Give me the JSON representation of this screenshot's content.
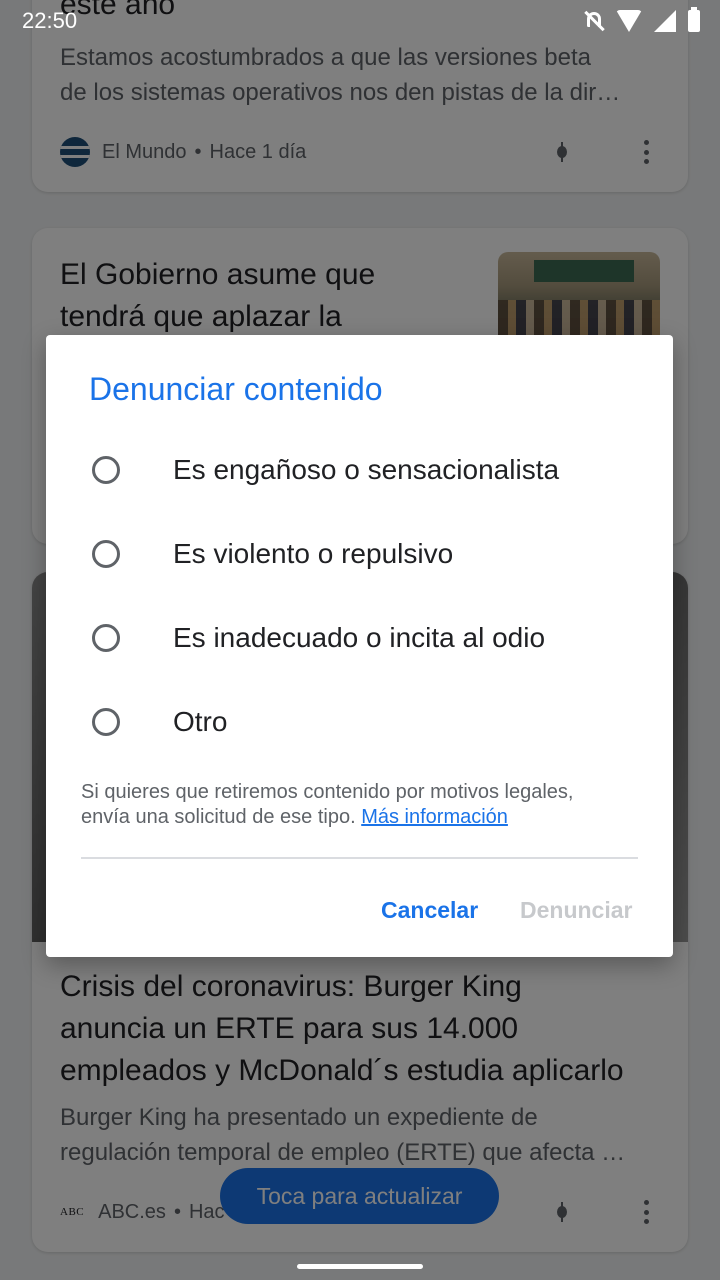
{
  "status_bar": {
    "time": "22:50",
    "icons": [
      "notifications-off-icon",
      "wifi-icon",
      "signal-icon",
      "battery-icon"
    ]
  },
  "feed": {
    "card1": {
      "title_partial": "este año",
      "snippet_line1": "Estamos acostumbrados a que las versiones beta",
      "snippet_line2": "de los sistemas operativos nos den pistas de la dir…",
      "publisher": "El Mundo",
      "time": "Hace 1 día"
    },
    "card2": {
      "title_line1": "El Gobierno asume que",
      "title_line2": "tendrá que aplazar la"
    },
    "card3": {
      "title_line1": "Crisis del coronavirus: Burger King",
      "title_line2": "anuncia un ERTE para sus 14.000",
      "title_line3": "empleados y McDonald´s estudia aplicarlo",
      "snippet_line1": "Burger King ha presentado un expediente de",
      "snippet_line2": "regulación temporal de empleo (ERTE) que afecta …",
      "publisher_logo": "ABC",
      "publisher": "ABC.es",
      "time_partial": "Hac"
    },
    "refresh_button": "Toca para actualizar"
  },
  "dialog": {
    "title": "Denunciar contenido",
    "options": [
      {
        "label": "Es engañoso o sensacionalista",
        "selected": false
      },
      {
        "label": "Es violento o repulsivo",
        "selected": false
      },
      {
        "label": "Es inadecuado o incita al odio",
        "selected": false
      },
      {
        "label": "Otro",
        "selected": false
      }
    ],
    "legal_text_line1": "Si quieres que retiremos contenido por motivos legales,",
    "legal_text_line2": "envía una solicitud de ese tipo.",
    "legal_link": "Más información",
    "cancel_label": "Cancelar",
    "report_label": "Denunciar"
  },
  "colors": {
    "accent": "#1a73e8",
    "disabled": "#c7c9cc",
    "scrim": "rgba(0,0,0,0.5)"
  }
}
